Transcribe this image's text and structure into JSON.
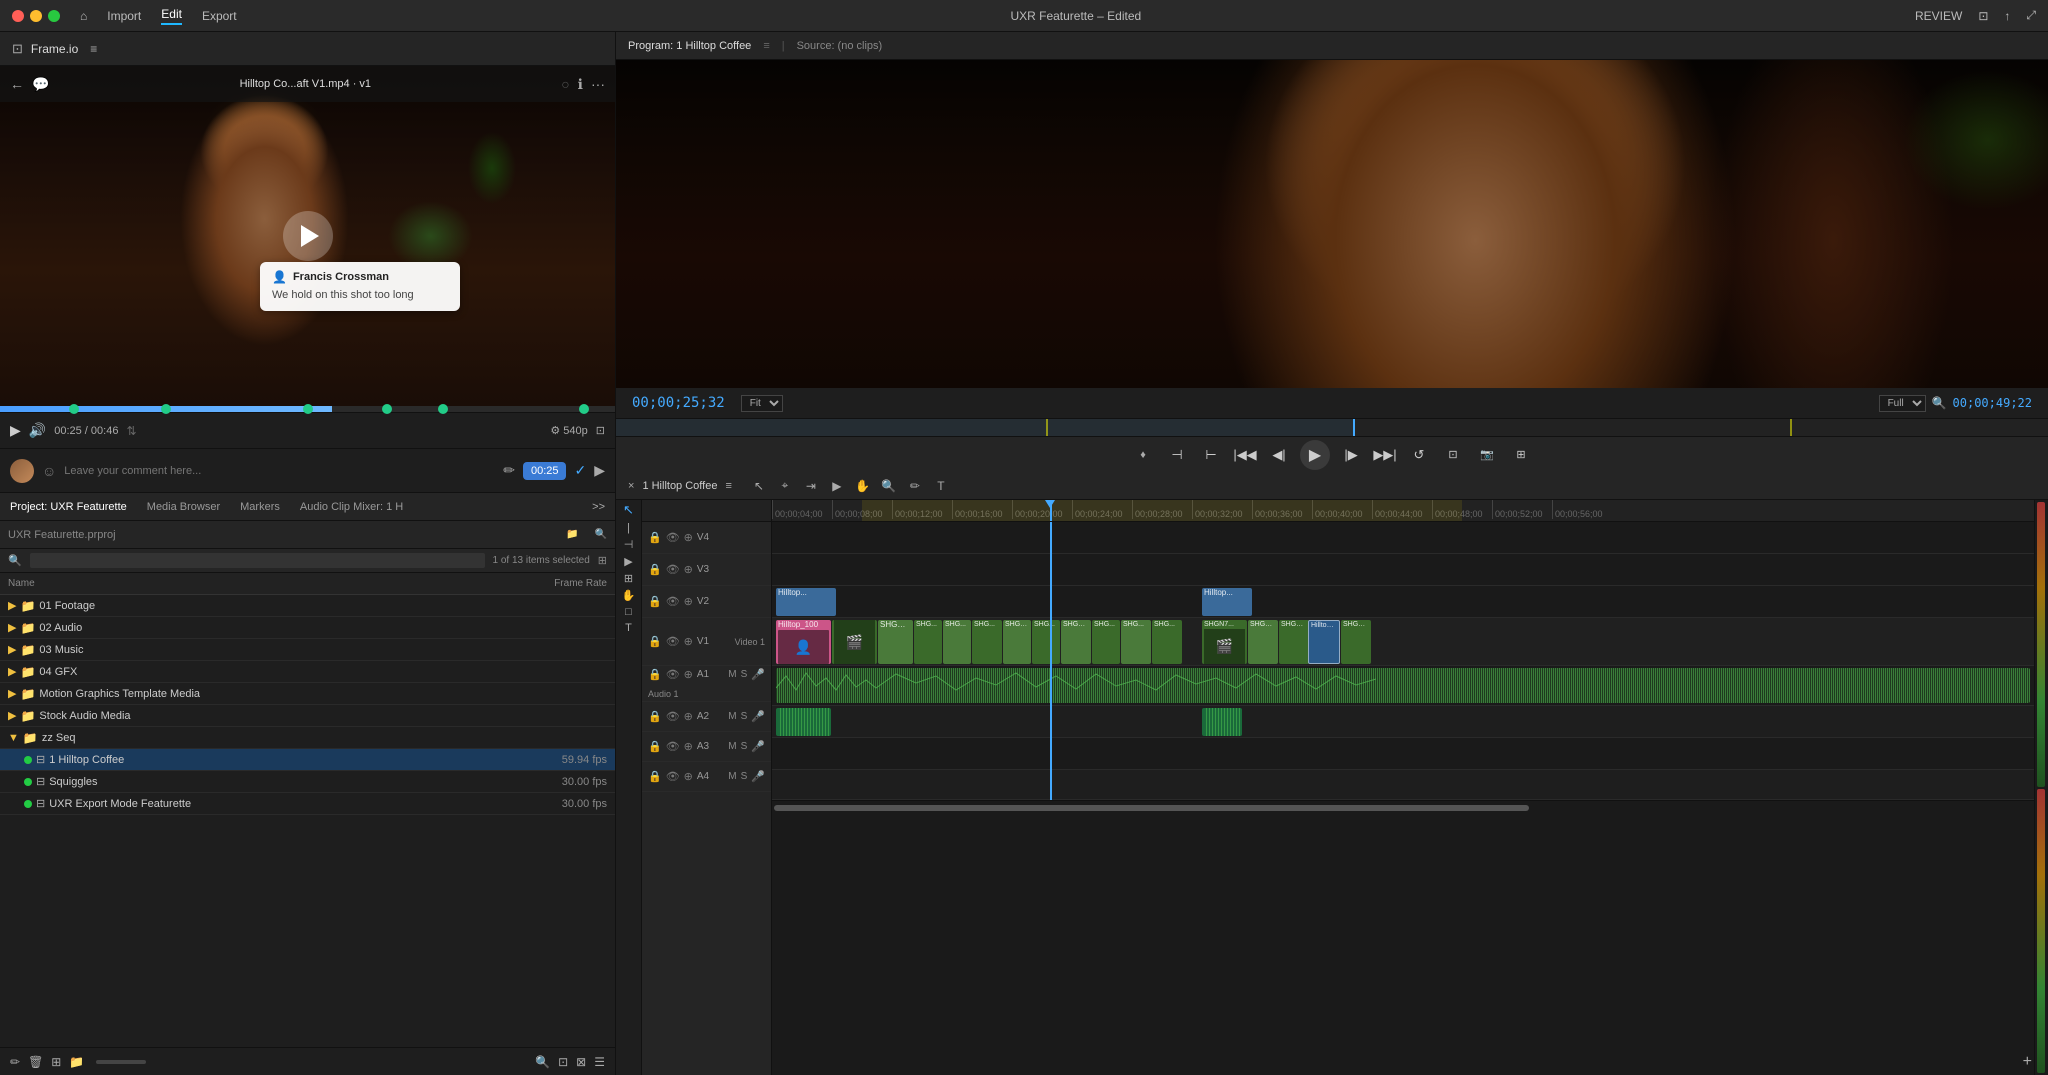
{
  "app": {
    "title": "UXR Featurette – Edited",
    "menu": {
      "home_icon": "⌂",
      "items": [
        "Import",
        "Edit",
        "Export"
      ]
    },
    "top_right": [
      "REVIEW"
    ]
  },
  "frameio_panel": {
    "title": "Frame.io",
    "video_title": "Hilltop Co...aft V1.mp4 · v1",
    "time_current": "00:25",
    "time_total": "00:46",
    "quality": "540p",
    "comment_placeholder": "Leave your comment here...",
    "comment_time": "00:25",
    "comment": {
      "user": "Francis Crossman",
      "text": "We hold on this shot too long"
    },
    "progress_markers": [
      0.12,
      0.27,
      0.5,
      0.63,
      0.72,
      0.95
    ]
  },
  "project_panel": {
    "tabs": [
      "Project: UXR Featurette",
      "Media Browser",
      "Markers",
      "Audio Clip Mixer: 1 H"
    ],
    "project_name": "UXR Featurette.prproj",
    "items_count": "1 of 13 items selected",
    "columns": {
      "name": "Name",
      "fps": "Frame Rate"
    },
    "folders": [
      {
        "name": "01 Footage",
        "type": "folder"
      },
      {
        "name": "02 Audio",
        "type": "folder"
      },
      {
        "name": "03 Music",
        "type": "folder"
      },
      {
        "name": "04 GFX",
        "type": "folder"
      },
      {
        "name": "Motion Graphics Template Media",
        "type": "folder"
      },
      {
        "name": "Stock Audio Media",
        "type": "folder"
      },
      {
        "name": "zz Seq",
        "type": "folder",
        "expanded": true
      }
    ],
    "sequences": [
      {
        "name": "1 Hilltop Coffee",
        "fps": "59.94 fps",
        "selected": true,
        "color": "green"
      },
      {
        "name": "Squiggles",
        "fps": "30.00 fps",
        "color": "green"
      },
      {
        "name": "UXR Export Mode Featurette",
        "fps": "30.00 fps",
        "color": "green"
      }
    ],
    "bottom_icons": [
      "✏️",
      "🗑️",
      "⊞",
      "📁",
      "🔍",
      "⊡",
      "☰"
    ]
  },
  "program_monitor": {
    "tabs": [
      "Program: 1 Hilltop Coffee",
      "Source: (no clips)"
    ],
    "timecode": "00;00;25;32",
    "duration": "00;00;49;22",
    "zoom": "Fit",
    "zoom_level": "Full"
  },
  "timeline": {
    "sequence_name": "1 Hilltop Coffee",
    "playhead_time": "00;00;25;32",
    "ruler_marks": [
      "00;00;04;00",
      "00;00;08;00",
      "00;00;12;00",
      "00;00;16;00",
      "00;00;20;00",
      "00;00;24;00",
      "00;00;28;00",
      "00;00;32;00",
      "00;00;36;00",
      "00;00;40;00",
      "00;00;44;00",
      "00;00;48;00",
      "00;00;52;00",
      "00;00;56;00"
    ],
    "tracks": {
      "video": [
        {
          "name": "V4",
          "lock": true,
          "vis": true
        },
        {
          "name": "V3",
          "lock": true,
          "vis": true
        },
        {
          "name": "V2",
          "lock": true,
          "vis": true
        },
        {
          "name": "V1",
          "lock": true,
          "vis": true,
          "label": "Video 1"
        },
        {
          "name": "A1",
          "lock": true,
          "label": "Audio 1",
          "m": "M",
          "s": "S"
        },
        {
          "name": "A2",
          "lock": true,
          "m": "M",
          "s": "S"
        },
        {
          "name": "A3",
          "lock": true,
          "m": "M",
          "s": "S"
        },
        {
          "name": "A4",
          "lock": true,
          "m": "M",
          "s": "S"
        }
      ]
    }
  }
}
